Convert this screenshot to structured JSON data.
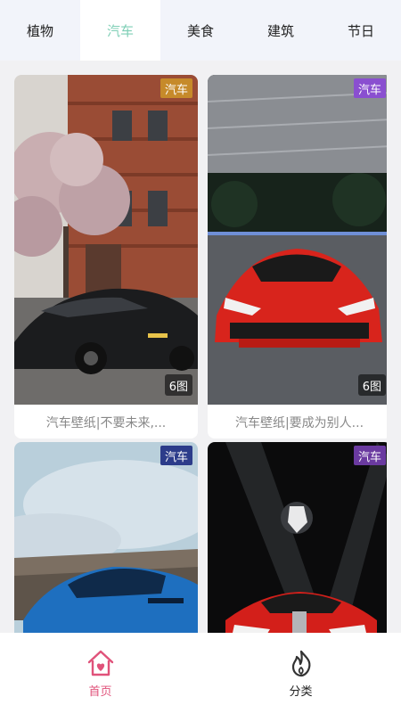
{
  "tabs": [
    {
      "label": "植物",
      "active": false
    },
    {
      "label": "汽车",
      "active": true
    },
    {
      "label": "美食",
      "active": false
    },
    {
      "label": "建筑",
      "active": false
    },
    {
      "label": "节日",
      "active": false
    }
  ],
  "cards": [
    {
      "badge": "汽车",
      "badge_color": "#c68a2a",
      "count": "6图",
      "caption": "汽车壁纸|不要未来,..."
    },
    {
      "badge": "汽车",
      "badge_color": "#8a4fd0",
      "count": "6图",
      "caption": "汽车壁纸|要成为别人..."
    },
    {
      "badge": "汽车",
      "badge_color": "#2c3c8a"
    },
    {
      "badge": "汽车",
      "badge_color": "#6a3aa0"
    }
  ],
  "nav": {
    "home_label": "首页",
    "category_label": "分类"
  },
  "colors": {
    "tab_active": "#7fcfb6",
    "nav_active": "#e0527a"
  }
}
